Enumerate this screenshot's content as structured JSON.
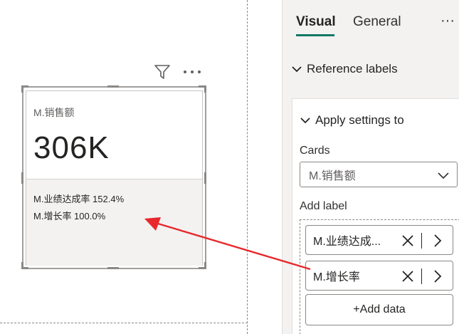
{
  "card": {
    "title": "M.销售额",
    "value": "306K",
    "ref_lines": [
      "M.业绩达成率 152.4%",
      "M.增长率 100.0%"
    ]
  },
  "visual_header": {
    "filter_icon": "filter-icon",
    "more_icon": "more-options-icon"
  },
  "pane": {
    "tabs": [
      {
        "label": "Visual",
        "active": true
      },
      {
        "label": "General",
        "active": false
      }
    ],
    "more_label": "···",
    "section_title": "Reference labels",
    "apply_title": "Apply settings to",
    "cards_label": "Cards",
    "cards_selected": "M.销售额",
    "add_label_title": "Add label",
    "labels": [
      "M.业绩达成...",
      "M.增长率"
    ],
    "add_data_label": "+Add data"
  },
  "colors": {
    "accent": "#117865",
    "annotation_arrow": "#e8282b"
  }
}
